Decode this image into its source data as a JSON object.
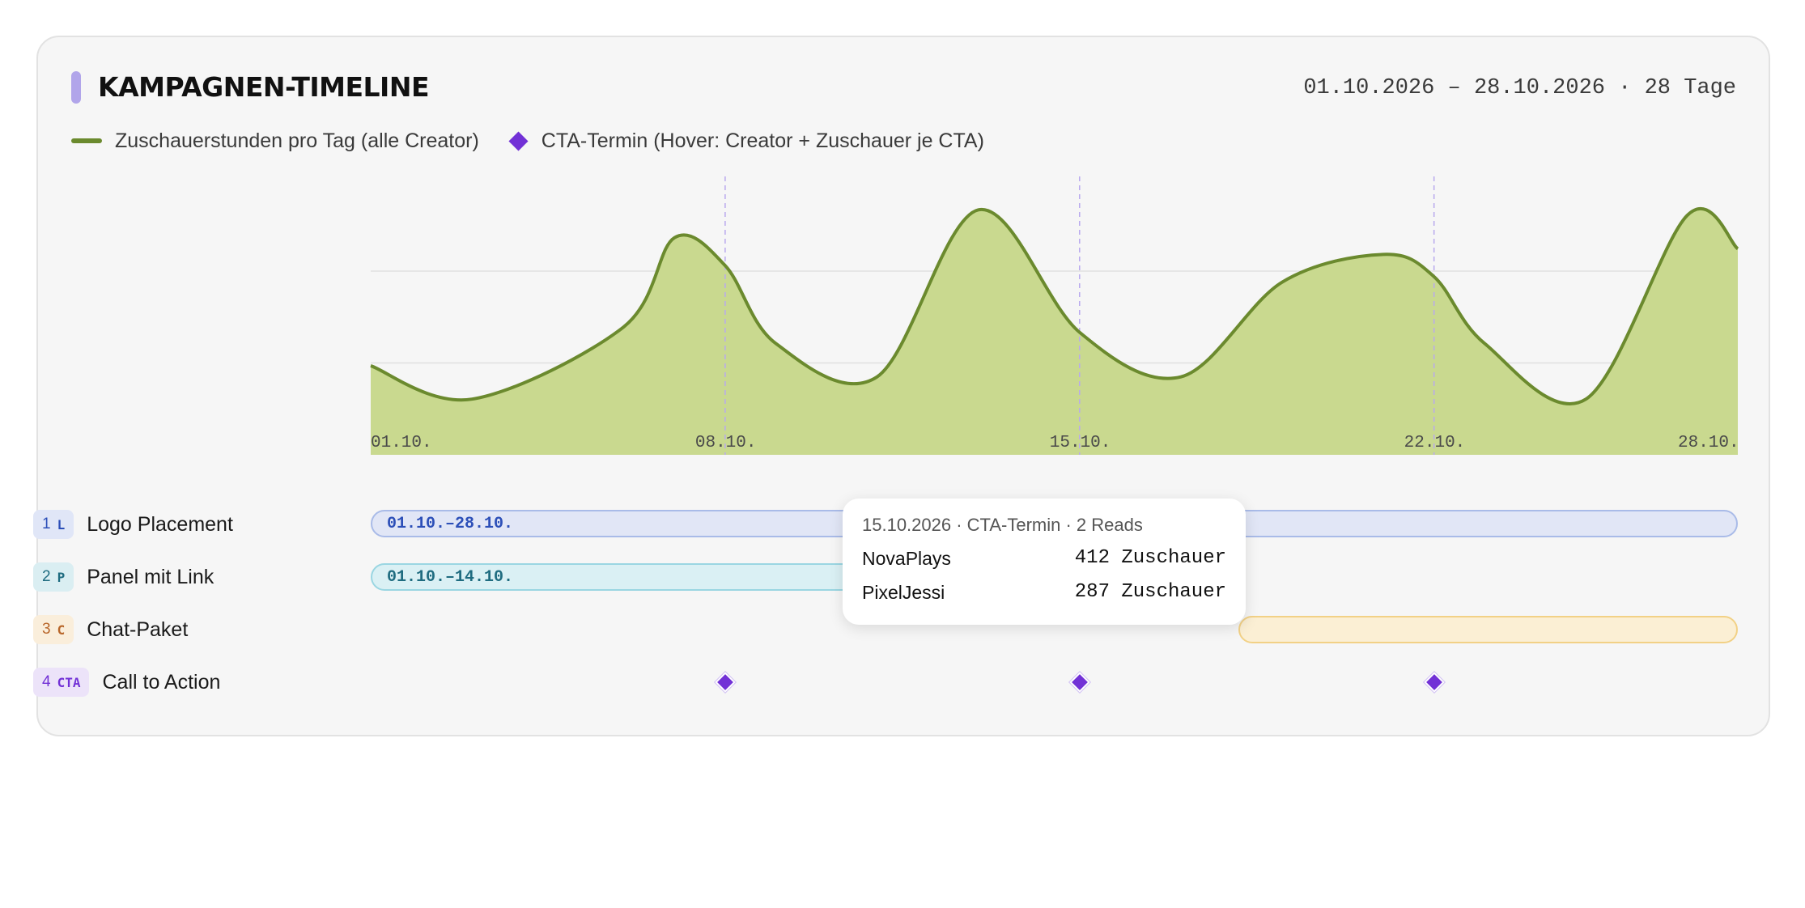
{
  "header": {
    "title": "KAMPAGNEN-TIMELINE",
    "date_range": "01.10.2026 – 28.10.2026 · 28 Tage"
  },
  "legend": {
    "line_label": "Zuschauerstunden pro Tag (alle Creator)",
    "marker_label": "CTA-Termin (Hover: Creator + Zuschauer je CTA)"
  },
  "colors": {
    "area_fill": "#c9d98f",
    "line": "#6b8a2e",
    "cta": "#7231d6",
    "title_accent": "#b1a5ea"
  },
  "chart_data": {
    "type": "area",
    "x_start": "01.10.",
    "x_end": "28.10.",
    "x_ticks": [
      "01.10.",
      "08.10.",
      "15.10.",
      "22.10.",
      "28.10."
    ],
    "x": [
      1,
      3,
      6,
      7,
      8,
      9,
      11,
      13,
      15,
      17,
      19,
      21,
      22,
      23,
      25,
      27,
      28
    ],
    "values": [
      32,
      20,
      46,
      78,
      68,
      40,
      28,
      88,
      44,
      28,
      62,
      72,
      64,
      40,
      20,
      86,
      74
    ],
    "ylim": [
      0,
      100
    ],
    "grid": "horizontal",
    "cta_markers_x": [
      8,
      15,
      22
    ]
  },
  "rows": [
    {
      "num": "1",
      "code": "L",
      "label": "Logo Placement",
      "bar_text": "01.10.–28.10."
    },
    {
      "num": "2",
      "code": "P",
      "label": "Panel mit Link",
      "bar_text": "01.10.–14.10."
    },
    {
      "num": "3",
      "code": "C",
      "label": "Chat-Paket",
      "bar_text": ""
    },
    {
      "num": "4",
      "code": "CTA",
      "label": "Call to Action",
      "bar_text": ""
    }
  ],
  "tooltip": {
    "header": "15.10.2026 · CTA-Termin · 2 Reads",
    "entries": [
      {
        "name": "NovaPlays",
        "value": "412 Zuschauer"
      },
      {
        "name": "PixelJessi",
        "value": "287 Zuschauer"
      }
    ]
  }
}
